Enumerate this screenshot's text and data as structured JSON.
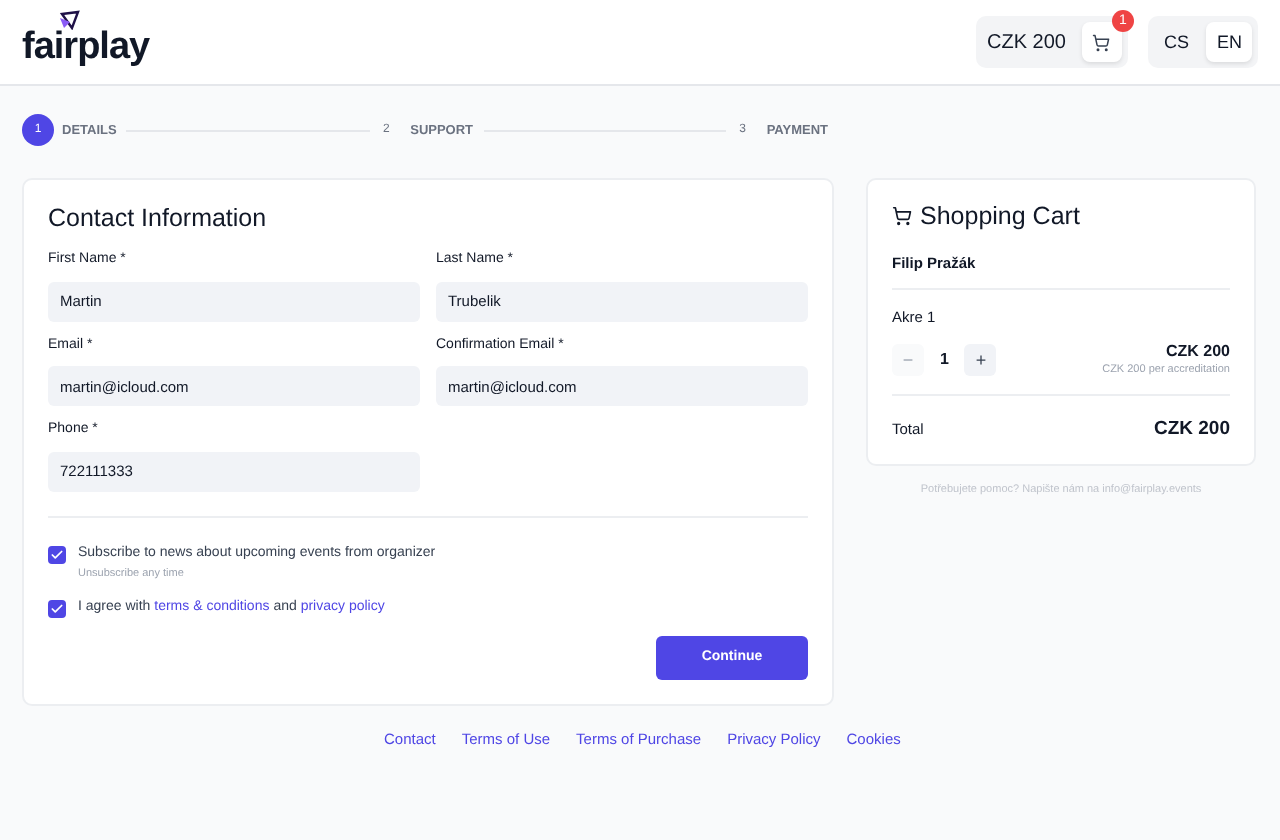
{
  "header": {
    "logo": "fairplay",
    "cart_total": "CZK 200",
    "cart_badge": "1",
    "languages": [
      {
        "label": "CS",
        "selected": false
      },
      {
        "label": "EN",
        "selected": true
      }
    ]
  },
  "steps": [
    {
      "number": "1",
      "label": "DETAILS",
      "selected": true
    },
    {
      "number": "2",
      "label": "SUPPORT",
      "selected": false
    },
    {
      "number": "3",
      "label": "PAYMENT",
      "selected": false
    }
  ],
  "contact": {
    "title": "Contact Information",
    "fields": [
      {
        "label": "First Name *",
        "value": "Martin"
      },
      {
        "label": "Last Name *",
        "value": "Trubelik"
      },
      {
        "label": "Email *",
        "value": "martin@icloud.com"
      },
      {
        "label": "Confirmation Email *",
        "value": "martin@icloud.com"
      },
      {
        "label": "Phone *",
        "value": "722111333"
      }
    ],
    "subscribe": {
      "label": "Subscribe to news about upcoming events from organizer",
      "hint": "Unsubscribe any time",
      "checked": true
    },
    "agree": {
      "before": "I agree with",
      "link1": "terms & conditions",
      "middle": "and",
      "link2": "privacy policy",
      "checked": true
    },
    "button": "Continue"
  },
  "cart": {
    "title": "Shopping Cart",
    "attendee": "Filip Pražák",
    "item": "Akre 1",
    "quantity": "1",
    "minus": "−",
    "plus": "+",
    "minus_disabled": true,
    "price": "CZK 200",
    "unit_price": "CZK 200 per accreditation",
    "total_label": "Total",
    "total": "CZK 200"
  },
  "help": "Potřebujete pomoc? Napište nám na info@fairplay.events",
  "footer_links": [
    "Contact",
    "Terms of Use",
    "Terms of Purchase",
    "Privacy Policy",
    "Cookies"
  ]
}
